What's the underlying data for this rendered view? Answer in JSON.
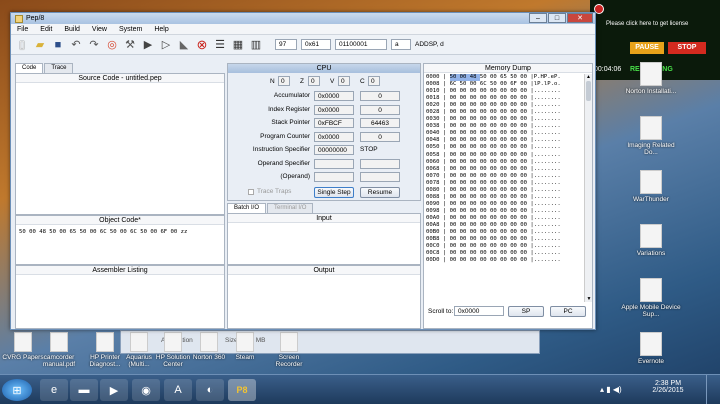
{
  "window": {
    "title": "Pep/8",
    "minimize": "–",
    "maximize": "□",
    "close": "✕"
  },
  "menu": [
    "File",
    "Edit",
    "Build",
    "View",
    "System",
    "Help"
  ],
  "toolbar_fields": {
    "dec": "97",
    "hex": "0x61",
    "bin": "01100001",
    "char": "a",
    "instr": "ADDSP, d"
  },
  "left": {
    "tabs": [
      "Code",
      "Trace"
    ],
    "source_title": "Source Code - untitled.pep",
    "object_title": "Object Code*",
    "object_code": "50 00 48 50 00 65 50 00 6C 50 00 6C 50 00 6F 00 zz",
    "listing_title": "Assembler Listing"
  },
  "cpu": {
    "title": "CPU",
    "flags": [
      {
        "k": "N",
        "v": "0"
      },
      {
        "k": "Z",
        "v": "0"
      },
      {
        "k": "V",
        "v": "0"
      },
      {
        "k": "C",
        "v": "0"
      }
    ],
    "rows": [
      {
        "label": "Accumulator",
        "hex": "0x0000",
        "dec": "0"
      },
      {
        "label": "Index Register",
        "hex": "0x0000",
        "dec": "0"
      },
      {
        "label": "Stack Pointer",
        "hex": "0xFBCF",
        "dec": "64463"
      },
      {
        "label": "Program Counter",
        "hex": "0x0000",
        "dec": "0"
      },
      {
        "label": "Instruction Specifier",
        "hex": "00000000",
        "dec": "STOP"
      },
      {
        "label": "Operand Specifier",
        "hex": "",
        "dec": ""
      },
      {
        "label": "(Operand)",
        "hex": "",
        "dec": ""
      }
    ],
    "trace_traps": "Trace Traps",
    "single_step": "Single Step",
    "resume": "Resume"
  },
  "io": {
    "tabs": [
      "Batch I/O",
      "Terminal I/O"
    ],
    "input_title": "Input",
    "output_title": "Output"
  },
  "memory": {
    "title": "Memory Dump",
    "lines": [
      "0000 | 50 00 48 50 00 65 50 00 |P.HP.eP.",
      "0008 | 6C 50 00 6C 50 00 6F 00 |lP.lP.o.",
      "0010 | 00 00 00 00 00 00 00 00 |........",
      "0018 | 00 00 00 00 00 00 00 00 |........",
      "0020 | 00 00 00 00 00 00 00 00 |........",
      "0028 | 00 00 00 00 00 00 00 00 |........",
      "0030 | 00 00 00 00 00 00 00 00 |........",
      "0038 | 00 00 00 00 00 00 00 00 |........",
      "0040 | 00 00 00 00 00 00 00 00 |........",
      "0048 | 00 00 00 00 00 00 00 00 |........",
      "0050 | 00 00 00 00 00 00 00 00 |........",
      "0058 | 00 00 00 00 00 00 00 00 |........",
      "0060 | 00 00 00 00 00 00 00 00 |........",
      "0068 | 00 00 00 00 00 00 00 00 |........",
      "0070 | 00 00 00 00 00 00 00 00 |........",
      "0078 | 00 00 00 00 00 00 00 00 |........",
      "0080 | 00 00 00 00 00 00 00 00 |........",
      "0088 | 00 00 00 00 00 00 00 00 |........",
      "0090 | 00 00 00 00 00 00 00 00 |........",
      "0098 | 00 00 00 00 00 00 00 00 |........",
      "00A0 | 00 00 00 00 00 00 00 00 |........",
      "00A8 | 00 00 00 00 00 00 00 00 |........",
      "00B0 | 00 00 00 00 00 00 00 00 |........",
      "00B8 | 00 00 00 00 00 00 00 00 |........",
      "00C0 | 00 00 00 00 00 00 00 00 |........",
      "00C8 | 00 00 00 00 00 00 00 00 |........",
      "00D0 | 00 00 00 00 00 00 00 00 |........"
    ],
    "scroll_label": "Scroll to:",
    "scroll_value": "0x0000",
    "sp_btn": "SP",
    "pc_btn": "PC"
  },
  "behind": {
    "application": "Application",
    "size": "Size: 21.2 MB"
  },
  "desktop_left": [
    {
      "label": "CVRG Papers",
      "icon": "folder-icon"
    },
    {
      "label": "camcorder manual.pdf",
      "icon": "pdf-icon"
    },
    {
      "label": "HP Printer Diagnost...",
      "icon": "printer-icon"
    },
    {
      "label": "Aquarius (Multi...",
      "icon": "app-icon"
    },
    {
      "label": "HP Solution Center",
      "icon": "app-icon"
    },
    {
      "label": "Norton 360",
      "icon": "norton-icon"
    },
    {
      "label": "Steam",
      "icon": "steam-icon"
    },
    {
      "label": "Screen Recorder",
      "icon": "recorder-icon"
    }
  ],
  "desktop_right": [
    {
      "label": "Norton Installati...",
      "icon": "norton-icon"
    },
    {
      "label": "Imaging Related Do...",
      "icon": "document-icon"
    },
    {
      "label": "WarThunder",
      "icon": "game-icon"
    },
    {
      "label": "Variations",
      "icon": "shortcut-icon"
    },
    {
      "label": "Apple Mobile Device Sup...",
      "icon": "apple-icon"
    },
    {
      "label": "Evernote",
      "icon": "evernote-icon"
    }
  ],
  "recorder": {
    "hint": "Please click here to get license",
    "pause": "PAUSE",
    "stop": "STOP",
    "time": "00:04:06",
    "status": "RECORDING"
  },
  "clock": {
    "time": "2:38 PM",
    "date": "2/26/2015"
  }
}
